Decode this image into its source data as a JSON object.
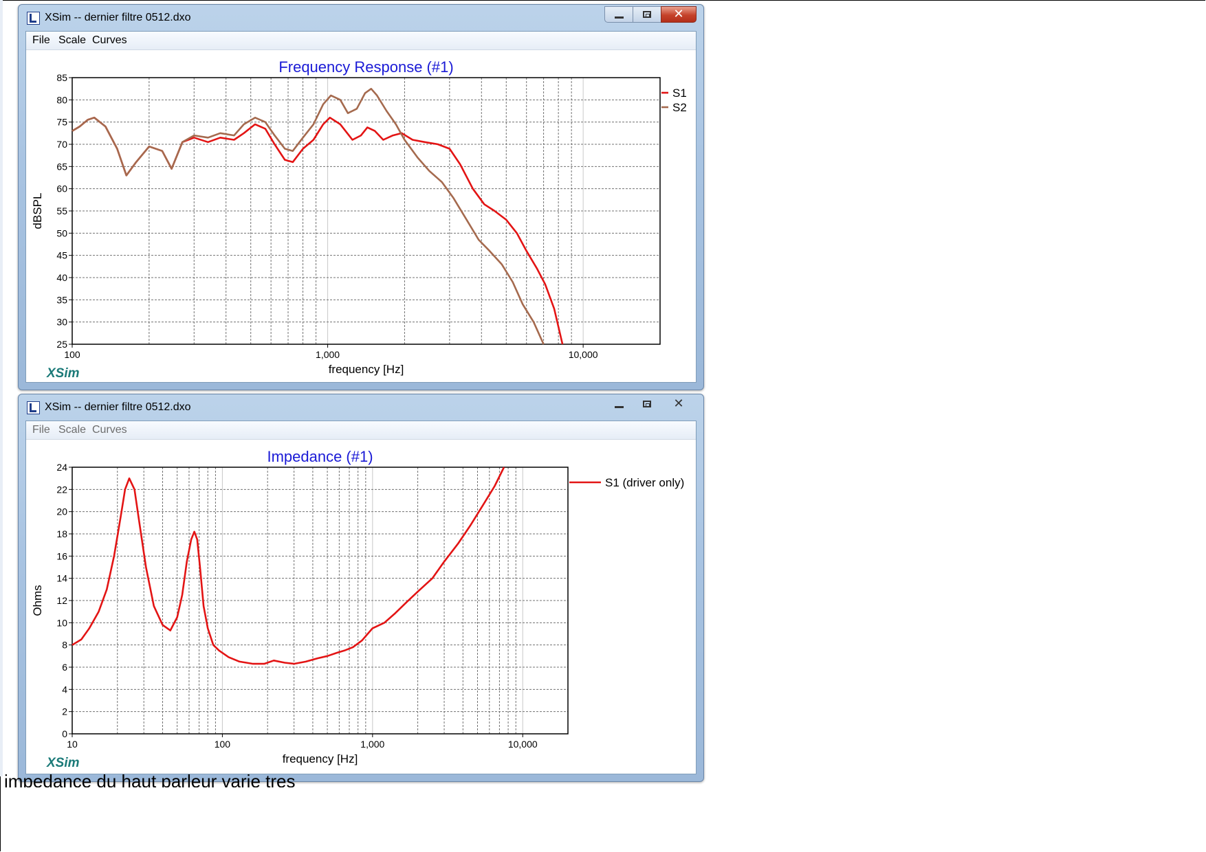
{
  "window_title": "XSim -- dernier filtre 0512.dxo",
  "menu": [
    "File",
    "Scale",
    "Curves"
  ],
  "brand": "XSim",
  "caption": "impedance du haut parleur varie tres",
  "chart_data": [
    {
      "type": "line",
      "title": "Frequency Response (#1)",
      "xlabel": "frequency [Hz]",
      "ylabel": "dBSPL",
      "xscale": "log",
      "xlim": [
        100,
        20000
      ],
      "ylim": [
        25,
        85
      ],
      "xticks": [
        {
          "value": 100,
          "label": "100"
        },
        {
          "value": 1000,
          "label": "1,000"
        },
        {
          "value": 10000,
          "label": "10,000"
        }
      ],
      "yticks": [
        25,
        30,
        35,
        40,
        45,
        50,
        55,
        60,
        65,
        70,
        75,
        80,
        85
      ],
      "grid": true,
      "legend": "right",
      "series": [
        {
          "name": "S1",
          "color": "#e31414",
          "x": [
            100,
            107,
            115,
            122,
            135,
            150,
            163,
            178,
            200,
            225,
            245,
            270,
            300,
            340,
            380,
            430,
            470,
            520,
            570,
            620,
            680,
            730,
            800,
            880,
            960,
            1020,
            1120,
            1250,
            1350,
            1430,
            1530,
            1650,
            1800,
            1950,
            2150,
            2400,
            2700,
            3000,
            3300,
            3700,
            4100,
            4500,
            5000,
            5500,
            6000,
            6600,
            7100,
            7700,
            8300
          ],
          "y": [
            73,
            74,
            75.5,
            76,
            74,
            69,
            63,
            66,
            69.5,
            68.5,
            64.5,
            70.5,
            71.5,
            70.5,
            71.5,
            71,
            72.5,
            74.5,
            73.5,
            70,
            66.5,
            66,
            69,
            71,
            74.5,
            76,
            74.5,
            71,
            72,
            73.8,
            73,
            71,
            72,
            72.5,
            71,
            70.5,
            70,
            69,
            65.5,
            60,
            56.5,
            55,
            53,
            50,
            46,
            42,
            38.5,
            33,
            25
          ]
        },
        {
          "name": "S2",
          "color": "#a56a4e",
          "x": [
            100,
            107,
            115,
            122,
            135,
            150,
            163,
            178,
            200,
            225,
            245,
            270,
            300,
            340,
            380,
            430,
            470,
            520,
            570,
            620,
            680,
            730,
            800,
            880,
            960,
            1030,
            1120,
            1200,
            1300,
            1400,
            1480,
            1560,
            1700,
            1850,
            2000,
            2250,
            2500,
            2800,
            3100,
            3500,
            3900,
            4300,
            4800,
            5300,
            5800,
            6400,
            7000
          ],
          "y": [
            73,
            74,
            75.5,
            76,
            74,
            69,
            63,
            66,
            69.5,
            68.5,
            64.5,
            70.5,
            72,
            71.5,
            72.5,
            72,
            74.5,
            76,
            75,
            72,
            69,
            68.5,
            71.5,
            74.5,
            79,
            81,
            80,
            77,
            78,
            81.5,
            82.5,
            81,
            77.5,
            74.5,
            71,
            67,
            64,
            61.5,
            58,
            53,
            48.5,
            46,
            43,
            39,
            34,
            30,
            25
          ]
        }
      ]
    },
    {
      "type": "line",
      "title": "Impedance (#1)",
      "xlabel": "frequency [Hz]",
      "ylabel": "Ohms",
      "xscale": "log",
      "xlim": [
        10,
        20000
      ],
      "ylim": [
        0,
        24
      ],
      "xticks": [
        {
          "value": 10,
          "label": "10"
        },
        {
          "value": 100,
          "label": "100"
        },
        {
          "value": 1000,
          "label": "1,000"
        },
        {
          "value": 10000,
          "label": "10,000"
        }
      ],
      "yticks": [
        0,
        2,
        4,
        6,
        8,
        10,
        12,
        14,
        16,
        18,
        20,
        22,
        24
      ],
      "grid": true,
      "legend": "right",
      "series": [
        {
          "name": "S1 (driver only)",
          "color": "#e31414",
          "x": [
            10,
            11.5,
            13,
            15,
            17,
            19,
            21,
            22.5,
            24,
            26,
            28,
            31,
            35,
            40,
            45,
            50,
            54,
            58,
            62,
            65,
            68,
            71,
            75,
            80,
            87,
            95,
            110,
            130,
            160,
            190,
            220,
            260,
            300,
            360,
            430,
            500,
            580,
            650,
            740,
            850,
            1000,
            1200,
            1400,
            1700,
            2000,
            2500,
            3000,
            3700,
            4500,
            5500,
            6500,
            7500
          ],
          "y": [
            8,
            8.5,
            9.5,
            11,
            13,
            16,
            19.5,
            22,
            23,
            22,
            19,
            15,
            11.5,
            9.8,
            9.3,
            10.5,
            12.5,
            15.5,
            17.5,
            18.2,
            17.5,
            15,
            11.5,
            9.5,
            8,
            7.5,
            6.9,
            6.5,
            6.3,
            6.3,
            6.6,
            6.4,
            6.3,
            6.5,
            6.8,
            7,
            7.3,
            7.5,
            7.8,
            8.4,
            9.5,
            10,
            10.8,
            11.9,
            12.8,
            14,
            15.5,
            17.1,
            18.8,
            20.7,
            22.3,
            24
          ]
        }
      ]
    }
  ]
}
